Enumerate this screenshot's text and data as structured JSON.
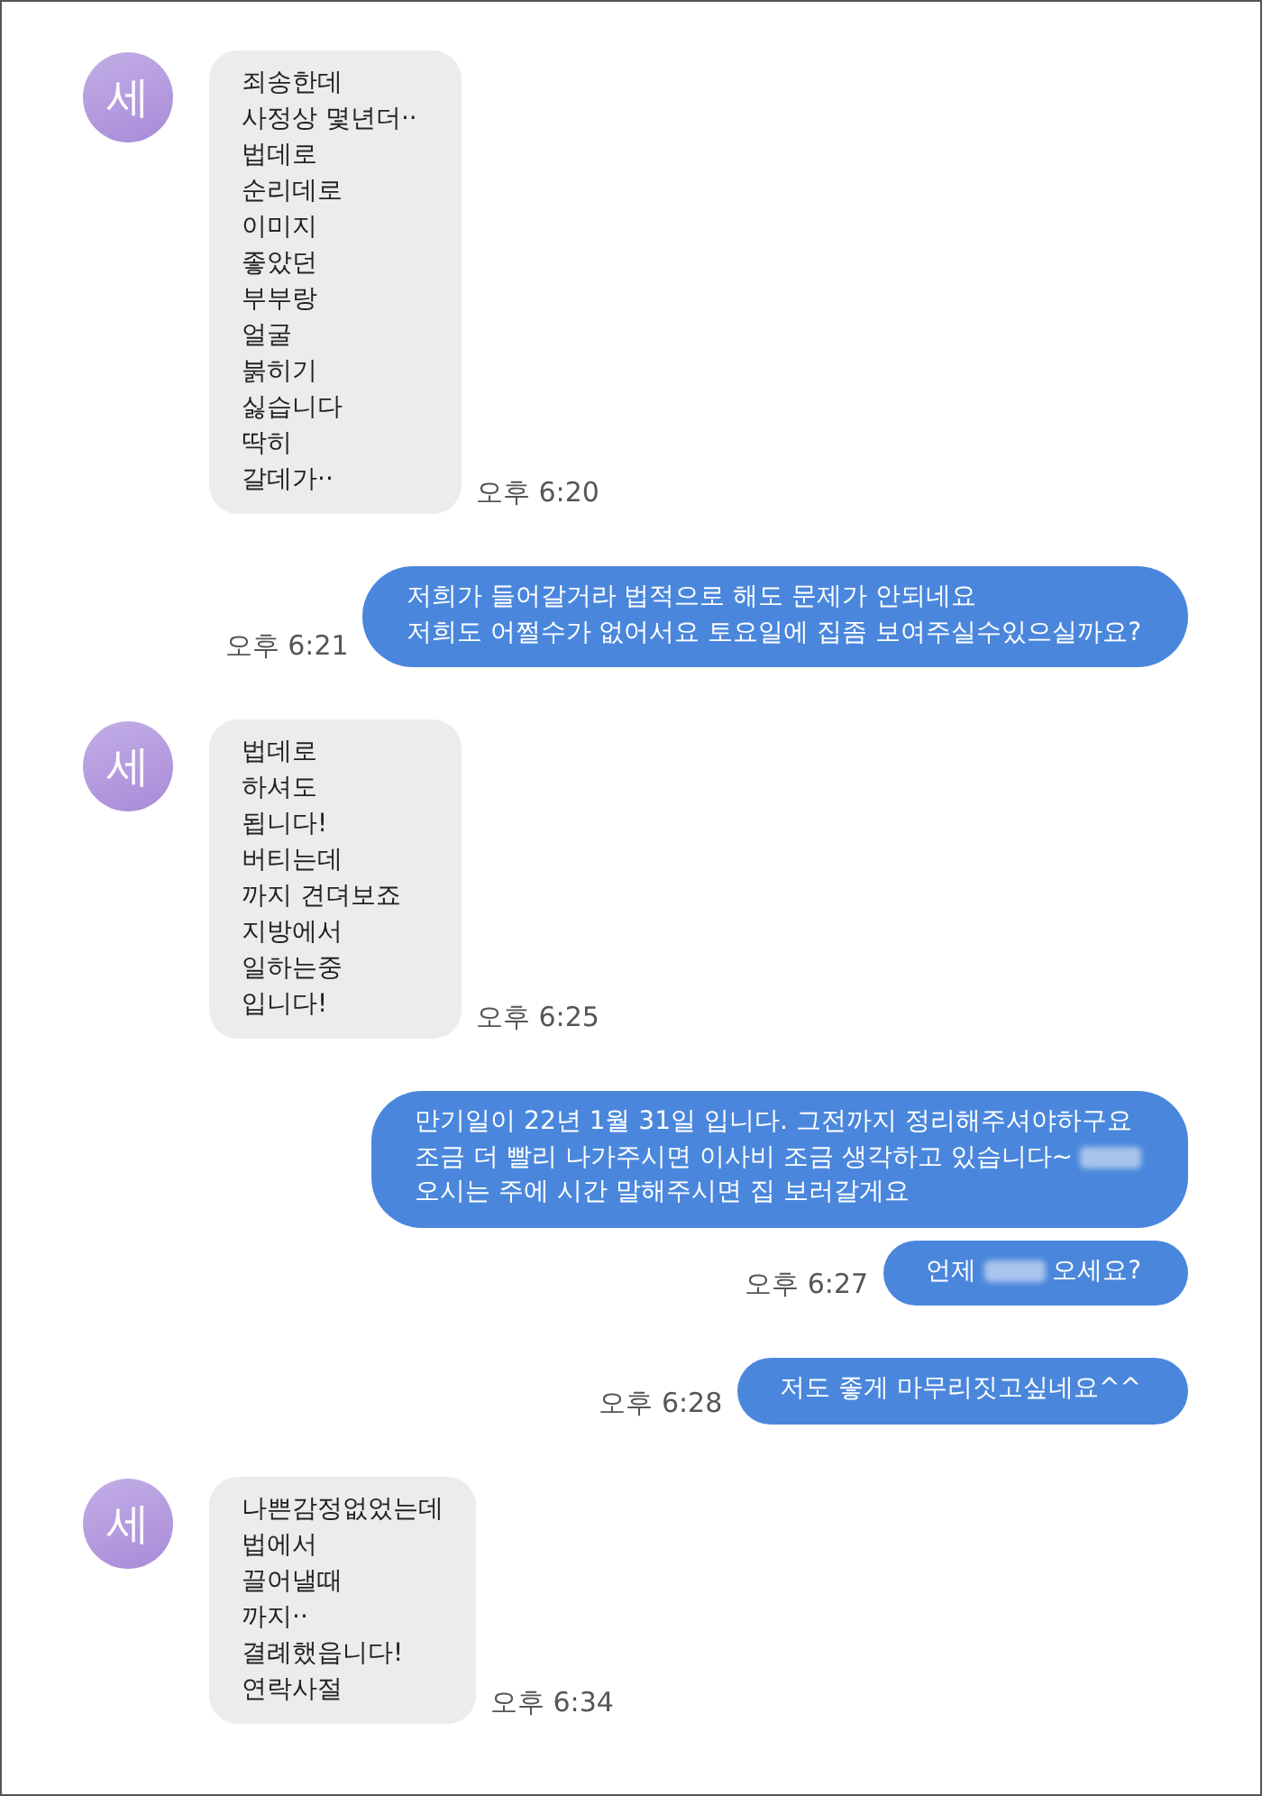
{
  "messages": [
    {
      "kind": "received",
      "avatar": "세",
      "time": "오후 6:20",
      "lines": [
        [
          {
            "kind": "text",
            "text": "죄송한데"
          }
        ],
        [
          {
            "kind": "text",
            "text": "사정상 몇년더··"
          }
        ],
        [
          {
            "kind": "text",
            "text": "법데로"
          }
        ],
        [
          {
            "kind": "text",
            "text": "순리데로"
          }
        ],
        [
          {
            "kind": "text",
            "text": "이미지"
          }
        ],
        [
          {
            "kind": "text",
            "text": "좋았던"
          }
        ],
        [
          {
            "kind": "text",
            "text": "부부랑"
          }
        ],
        [
          {
            "kind": "text",
            "text": "얼굴"
          }
        ],
        [
          {
            "kind": "text",
            "text": "붉히기"
          }
        ],
        [
          {
            "kind": "text",
            "text": "싫습니다"
          }
        ],
        [
          {
            "kind": "text",
            "text": "딱히"
          }
        ],
        [
          {
            "kind": "text",
            "text": "갈데가··"
          }
        ]
      ]
    },
    {
      "kind": "sent",
      "time": "오후 6:21",
      "lines": [
        [
          {
            "kind": "text",
            "text": "저희가 들어갈거라 법적으로 해도 문제가 안되네요"
          }
        ],
        [
          {
            "kind": "text",
            "text": "저희도 어쩔수가 없어서요 토요일에 집좀 보여주실수있으실까요?"
          }
        ]
      ]
    },
    {
      "kind": "received",
      "avatar": "세",
      "time": "오후 6:25",
      "lines": [
        [
          {
            "kind": "text",
            "text": "법데로"
          }
        ],
        [
          {
            "kind": "text",
            "text": "하셔도"
          }
        ],
        [
          {
            "kind": "text",
            "text": "됩니다!"
          }
        ],
        [
          {
            "kind": "text",
            "text": "버티는데"
          }
        ],
        [
          {
            "kind": "text",
            "text": "까지 견뎌보죠"
          }
        ],
        [
          {
            "kind": "text",
            "text": "지방에서"
          }
        ],
        [
          {
            "kind": "text",
            "text": "일하는중"
          }
        ],
        [
          {
            "kind": "text",
            "text": "입니다!"
          }
        ]
      ]
    },
    {
      "kind": "sent",
      "lines": [
        [
          {
            "kind": "text",
            "text": "만기일이 22년 1월 31일 입니다. 그전까지 정리해주셔야하구요"
          }
        ],
        [
          {
            "kind": "text",
            "text": "조금 더 빨리 나가주시면 이사비 조금 생각하고 있습니다~"
          },
          {
            "kind": "redacted"
          }
        ],
        [
          {
            "kind": "text",
            "text": "오시는 주에 시간 말해주시면 집 보러갈게요"
          }
        ]
      ]
    },
    {
      "kind": "sent",
      "time": "오후 6:27",
      "lines": [
        [
          {
            "kind": "text",
            "text": "언제"
          },
          {
            "kind": "redacted"
          },
          {
            "kind": "text",
            "text": "오세요?"
          }
        ]
      ]
    },
    {
      "kind": "sent",
      "time": "오후 6:28",
      "lines": [
        [
          {
            "kind": "text",
            "text": "저도 좋게 마무리짓고싶네요^^"
          }
        ]
      ]
    },
    {
      "kind": "received",
      "avatar": "세",
      "time": "오후 6:34",
      "lines": [
        [
          {
            "kind": "text",
            "text": "나쁜감정없었는데"
          }
        ],
        [
          {
            "kind": "text",
            "text": "법에서"
          }
        ],
        [
          {
            "kind": "text",
            "text": "끌어낼때"
          }
        ],
        [
          {
            "kind": "text",
            "text": "까지··"
          }
        ],
        [
          {
            "kind": "text",
            "text": "결례했읍니다!"
          }
        ],
        [
          {
            "kind": "text",
            "text": "연락사절"
          }
        ]
      ]
    }
  ]
}
